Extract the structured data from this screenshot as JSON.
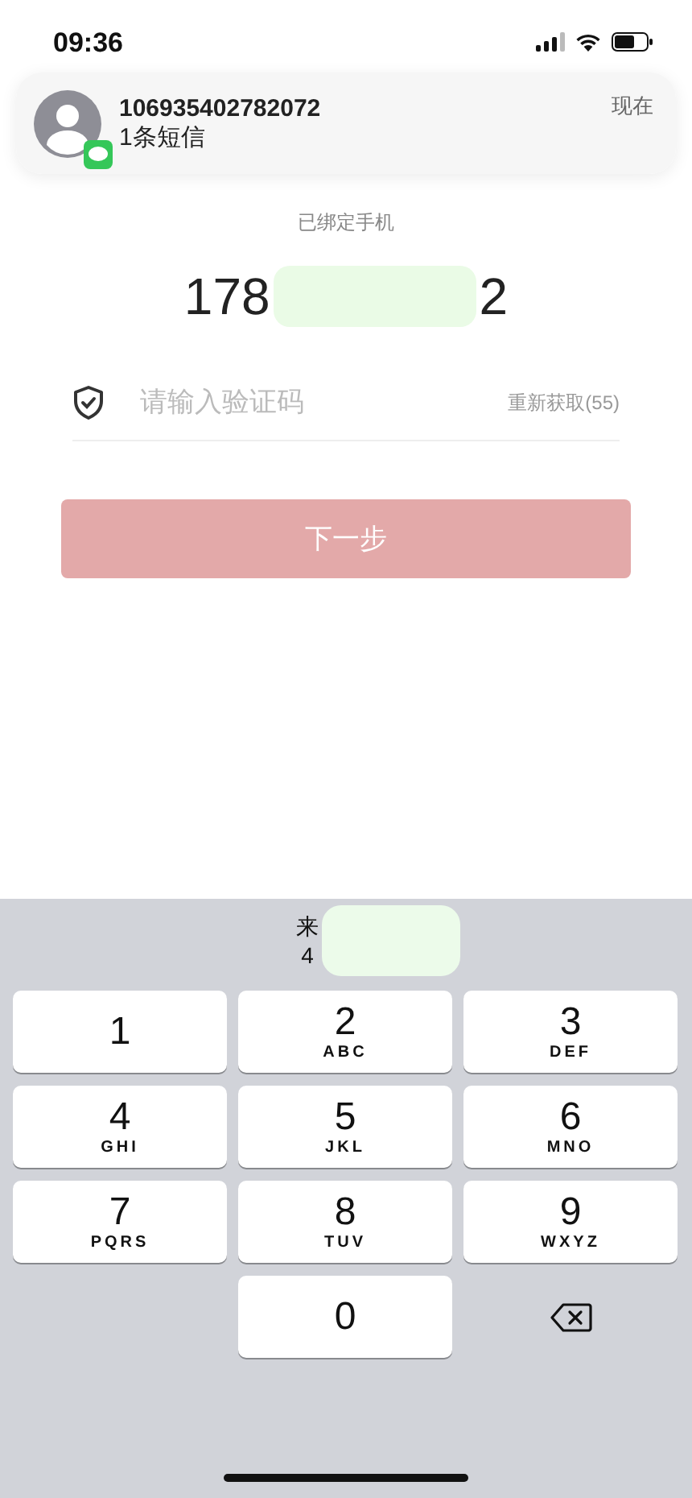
{
  "status_bar": {
    "time": "09:36"
  },
  "notification": {
    "sender": "106935402782072",
    "message": "1条短信",
    "time": "现在"
  },
  "bound_phone": {
    "label": "已绑定手机",
    "number_start": "178",
    "number_end": "2"
  },
  "code_field": {
    "placeholder": "请输入验证码",
    "resend": "重新获取(55)"
  },
  "next_button": {
    "label": "下一步",
    "disabled": true
  },
  "keyboard": {
    "suggestion": {
      "line_1": "来",
      "line_2": "4"
    },
    "keys": [
      {
        "kind": "digit",
        "digit": "1"
      },
      {
        "kind": "digit",
        "digit": "2",
        "letters": "ABC"
      },
      {
        "kind": "digit",
        "digit": "3",
        "letters": "DEF"
      },
      {
        "kind": "digit",
        "digit": "4",
        "letters": "GHI"
      },
      {
        "kind": "digit",
        "digit": "5",
        "letters": "JKL"
      },
      {
        "kind": "digit",
        "digit": "6",
        "letters": "MNO"
      },
      {
        "kind": "digit",
        "digit": "7",
        "letters": "PQRS"
      },
      {
        "kind": "digit",
        "digit": "8",
        "letters": "TUV"
      },
      {
        "kind": "digit",
        "digit": "9",
        "letters": "WXYZ"
      },
      {
        "kind": "blank"
      },
      {
        "kind": "digit",
        "digit": "0"
      },
      {
        "kind": "delete"
      }
    ]
  }
}
